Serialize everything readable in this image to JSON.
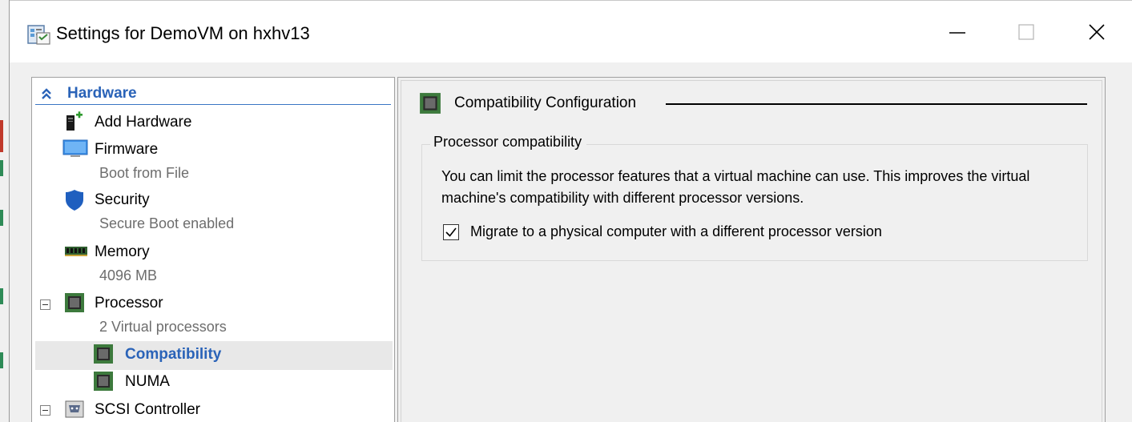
{
  "window": {
    "title": "Settings for DemoVM on hxhv13",
    "title_icon": "settings-window-icon",
    "controls": {
      "minimize": "minimize-icon",
      "maximize": "maximize-icon",
      "close": "close-icon"
    }
  },
  "tree": {
    "header": {
      "label": "Hardware",
      "icon": "collapse-chevrons-icon"
    },
    "items": [
      {
        "label": "Add Hardware",
        "icon": "add-hardware-icon"
      },
      {
        "label": "Firmware",
        "sublabel": "Boot from File",
        "icon": "firmware-monitor-icon"
      },
      {
        "label": "Security",
        "sublabel": "Secure Boot enabled",
        "icon": "shield-icon"
      },
      {
        "label": "Memory",
        "sublabel": "4096 MB",
        "icon": "memory-module-icon"
      },
      {
        "label": "Processor",
        "sublabel": "2 Virtual processors",
        "icon": "processor-chip-icon"
      },
      {
        "label": "Compatibility",
        "icon": "processor-chip-icon",
        "selected": true
      },
      {
        "label": "NUMA",
        "icon": "processor-chip-icon"
      },
      {
        "label": "SCSI Controller",
        "icon": "scsi-controller-icon"
      }
    ]
  },
  "content": {
    "section_title": "Compatibility Configuration",
    "section_icon": "processor-chip-icon",
    "group": {
      "legend": "Processor compatibility",
      "description": "You can limit the processor features that a virtual machine can use. This improves the virtual machine's compatibility with different processor versions.",
      "checkbox": {
        "label": "Migrate to a physical computer with a different processor version",
        "checked": true
      }
    }
  },
  "colors": {
    "accent": "#2a63b8",
    "chip_green": "#3d7a3d",
    "selection": "#e8e8e8",
    "shield_blue": "#1f5fbf"
  }
}
